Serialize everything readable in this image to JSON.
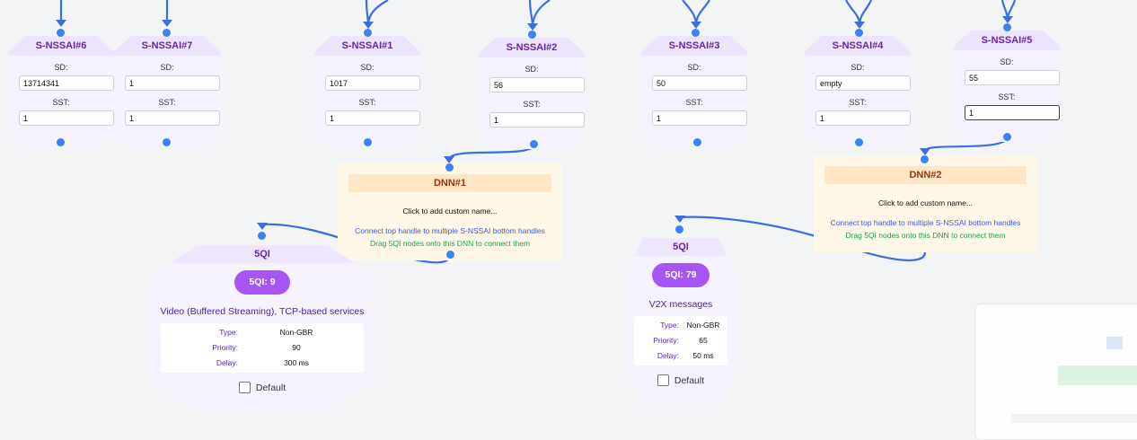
{
  "nssai_nodes": [
    {
      "id": "n6",
      "title": "S-NSSAI#6",
      "sd_label": "SD:",
      "sd_value": "13714341",
      "sst_label": "SST:",
      "sst_value": "1"
    },
    {
      "id": "n7",
      "title": "S-NSSAI#7",
      "sd_label": "SD:",
      "sd_value": "1",
      "sst_label": "SST:",
      "sst_value": "1"
    },
    {
      "id": "n1",
      "title": "S-NSSAI#1",
      "sd_label": "SD:",
      "sd_value": "1017",
      "sst_label": "SST:",
      "sst_value": "1"
    },
    {
      "id": "n2",
      "title": "S-NSSAI#2",
      "sd_label": "SD:",
      "sd_value": "56",
      "sst_label": "SST:",
      "sst_value": "1"
    },
    {
      "id": "n3",
      "title": "S-NSSAI#3",
      "sd_label": "SD:",
      "sd_value": "50",
      "sst_label": "SST:",
      "sst_value": "1"
    },
    {
      "id": "n4",
      "title": "S-NSSAI#4",
      "sd_label": "SD:",
      "sd_value": "empty",
      "sst_label": "SST:",
      "sst_value": "1"
    },
    {
      "id": "n5",
      "title": "S-NSSAI#5",
      "sd_label": "SD:",
      "sd_value": "55",
      "sst_label": "SST:",
      "sst_value": "1"
    }
  ],
  "dnn_nodes": [
    {
      "id": "d1",
      "title": "DNN#1",
      "custom_name": "Click to add custom name...",
      "hint_connect": "Connect top handle to multiple S-NSSAI bottom handles",
      "hint_drag": "Drag 5QI nodes onto this DNN to connect them"
    },
    {
      "id": "d2",
      "title": "DNN#2",
      "custom_name": "Click to add custom name...",
      "hint_connect": "Connect top handle to multiple S-NSSAI bottom handles",
      "hint_drag": "Drag 5QI nodes onto this DNN to connect them"
    }
  ],
  "qi_nodes": [
    {
      "id": "q9",
      "header": "5QI",
      "badge": "5QI: 9",
      "description": "Video (Buffered Streaming), TCP-based services",
      "type_label": "Type:",
      "type_value": "Non-GBR",
      "priority_label": "Priority:",
      "priority_value": "90",
      "delay_label": "Delay:",
      "delay_value": "300 ms",
      "default_label": "Default"
    },
    {
      "id": "q79",
      "header": "5QI",
      "badge": "5QI: 79",
      "description": "V2X messages",
      "type_label": "Type:",
      "type_value": "Non-GBR",
      "priority_label": "Priority:",
      "priority_value": "65",
      "delay_label": "Delay:",
      "delay_value": "50 ms",
      "default_label": "Default"
    }
  ],
  "colors": {
    "edge": "#3b6fe0",
    "handle": "#3b82f6",
    "accent_purple": "#a855f7"
  }
}
